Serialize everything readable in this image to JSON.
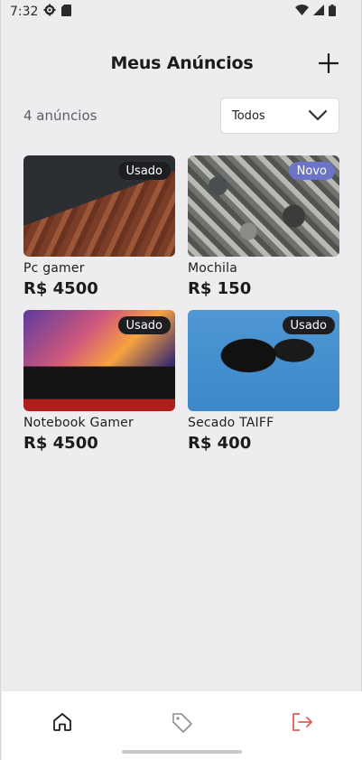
{
  "status_bar": {
    "time": "7:32",
    "icons": [
      "settings-icon",
      "sd-card-icon",
      "wifi-icon",
      "signal-icon",
      "battery-icon"
    ]
  },
  "header": {
    "title": "Meus Anúncios",
    "add_icon": "plus-icon"
  },
  "toolbar": {
    "count_label": "4 anúncios",
    "filter": {
      "selected": "Todos",
      "icon": "chevron-down-icon"
    }
  },
  "listings": [
    {
      "title": "Pc gamer",
      "price": "R$ 4500",
      "condition": "Usado",
      "condition_color": "#1e1e22"
    },
    {
      "title": "Mochila",
      "price": "R$ 150",
      "condition": "Novo",
      "condition_color": "#6b74c7"
    },
    {
      "title": "Notebook Gamer",
      "price": "R$ 4500",
      "condition": "Usado",
      "condition_color": "#1e1e22"
    },
    {
      "title": "Secado TAIFF",
      "price": "R$ 400",
      "condition": "Usado",
      "condition_color": "#1e1e22"
    }
  ],
  "bottom_nav": {
    "items": [
      {
        "icon": "home-icon"
      },
      {
        "icon": "tag-icon"
      },
      {
        "icon": "logout-icon",
        "color": "#e25c5c"
      }
    ]
  },
  "colors": {
    "background": "#edecee",
    "new_badge": "#6b74c7",
    "used_badge": "#1e1e22",
    "logout": "#e25c5c"
  }
}
